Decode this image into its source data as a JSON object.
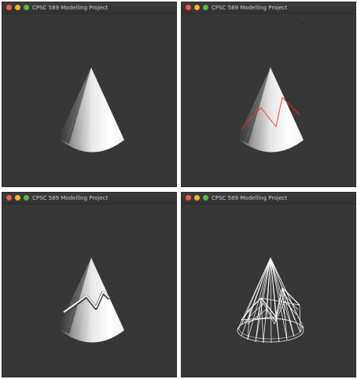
{
  "windows": [
    {
      "title": "CPSC 589 Modelling Project",
      "view": "shaded cone"
    },
    {
      "title": "CPSC 589 Modelling Project",
      "view": "shaded cone with red sketched curve"
    },
    {
      "title": "CPSC 589 Modelling Project",
      "view": "shaded cone with extruded stroke"
    },
    {
      "title": "CPSC 589 Modelling Project",
      "view": "wireframe cone"
    }
  ],
  "colors": {
    "window_bg": "#373737",
    "titlebar": "#363636",
    "close": "#e95c4c",
    "minimize": "#f2b52f",
    "maximize": "#55b948",
    "sketch_curve": "#ff2020",
    "wireframe": "#ffffff"
  }
}
